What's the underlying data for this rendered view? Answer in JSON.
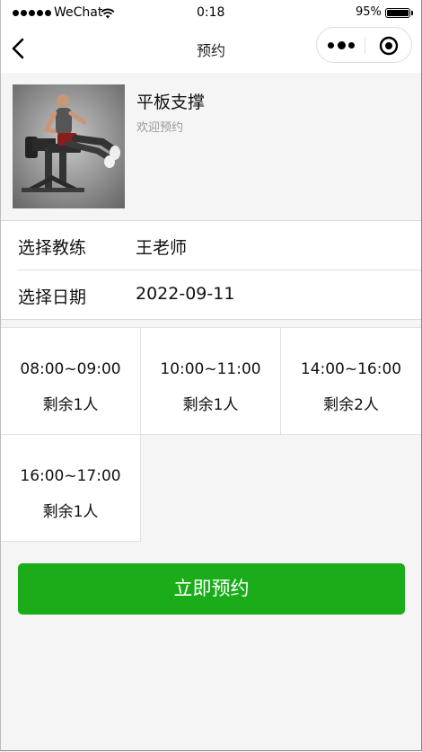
{
  "status_bar": {
    "carrier": "WeChat",
    "time": "0:18",
    "battery": "95%",
    "battery_level": 0.95
  },
  "nav": {
    "title": "预约",
    "back_icon": "chevron-left-icon",
    "more_icon": "more-dots-icon",
    "close_icon": "target-circle-icon"
  },
  "course": {
    "title": "平板支撑",
    "subtitle": "欢迎预约",
    "image_icon": "exercise-photo"
  },
  "form": {
    "coach_label": "选择教练",
    "coach_value": "王老师",
    "date_label": "选择日期",
    "date_value": "2022-09-11"
  },
  "slots": [
    {
      "time": "08:00~09:00",
      "remain": "剩余1人"
    },
    {
      "time": "10:00~11:00",
      "remain": "剩余1人"
    },
    {
      "time": "14:00~16:00",
      "remain": "剩余2人"
    },
    {
      "time": "16:00~17:00",
      "remain": "剩余1人"
    }
  ],
  "book_button_label": "立即预约",
  "colors": {
    "primary_green": "#1aad19",
    "page_background": "#f5f5f5"
  }
}
